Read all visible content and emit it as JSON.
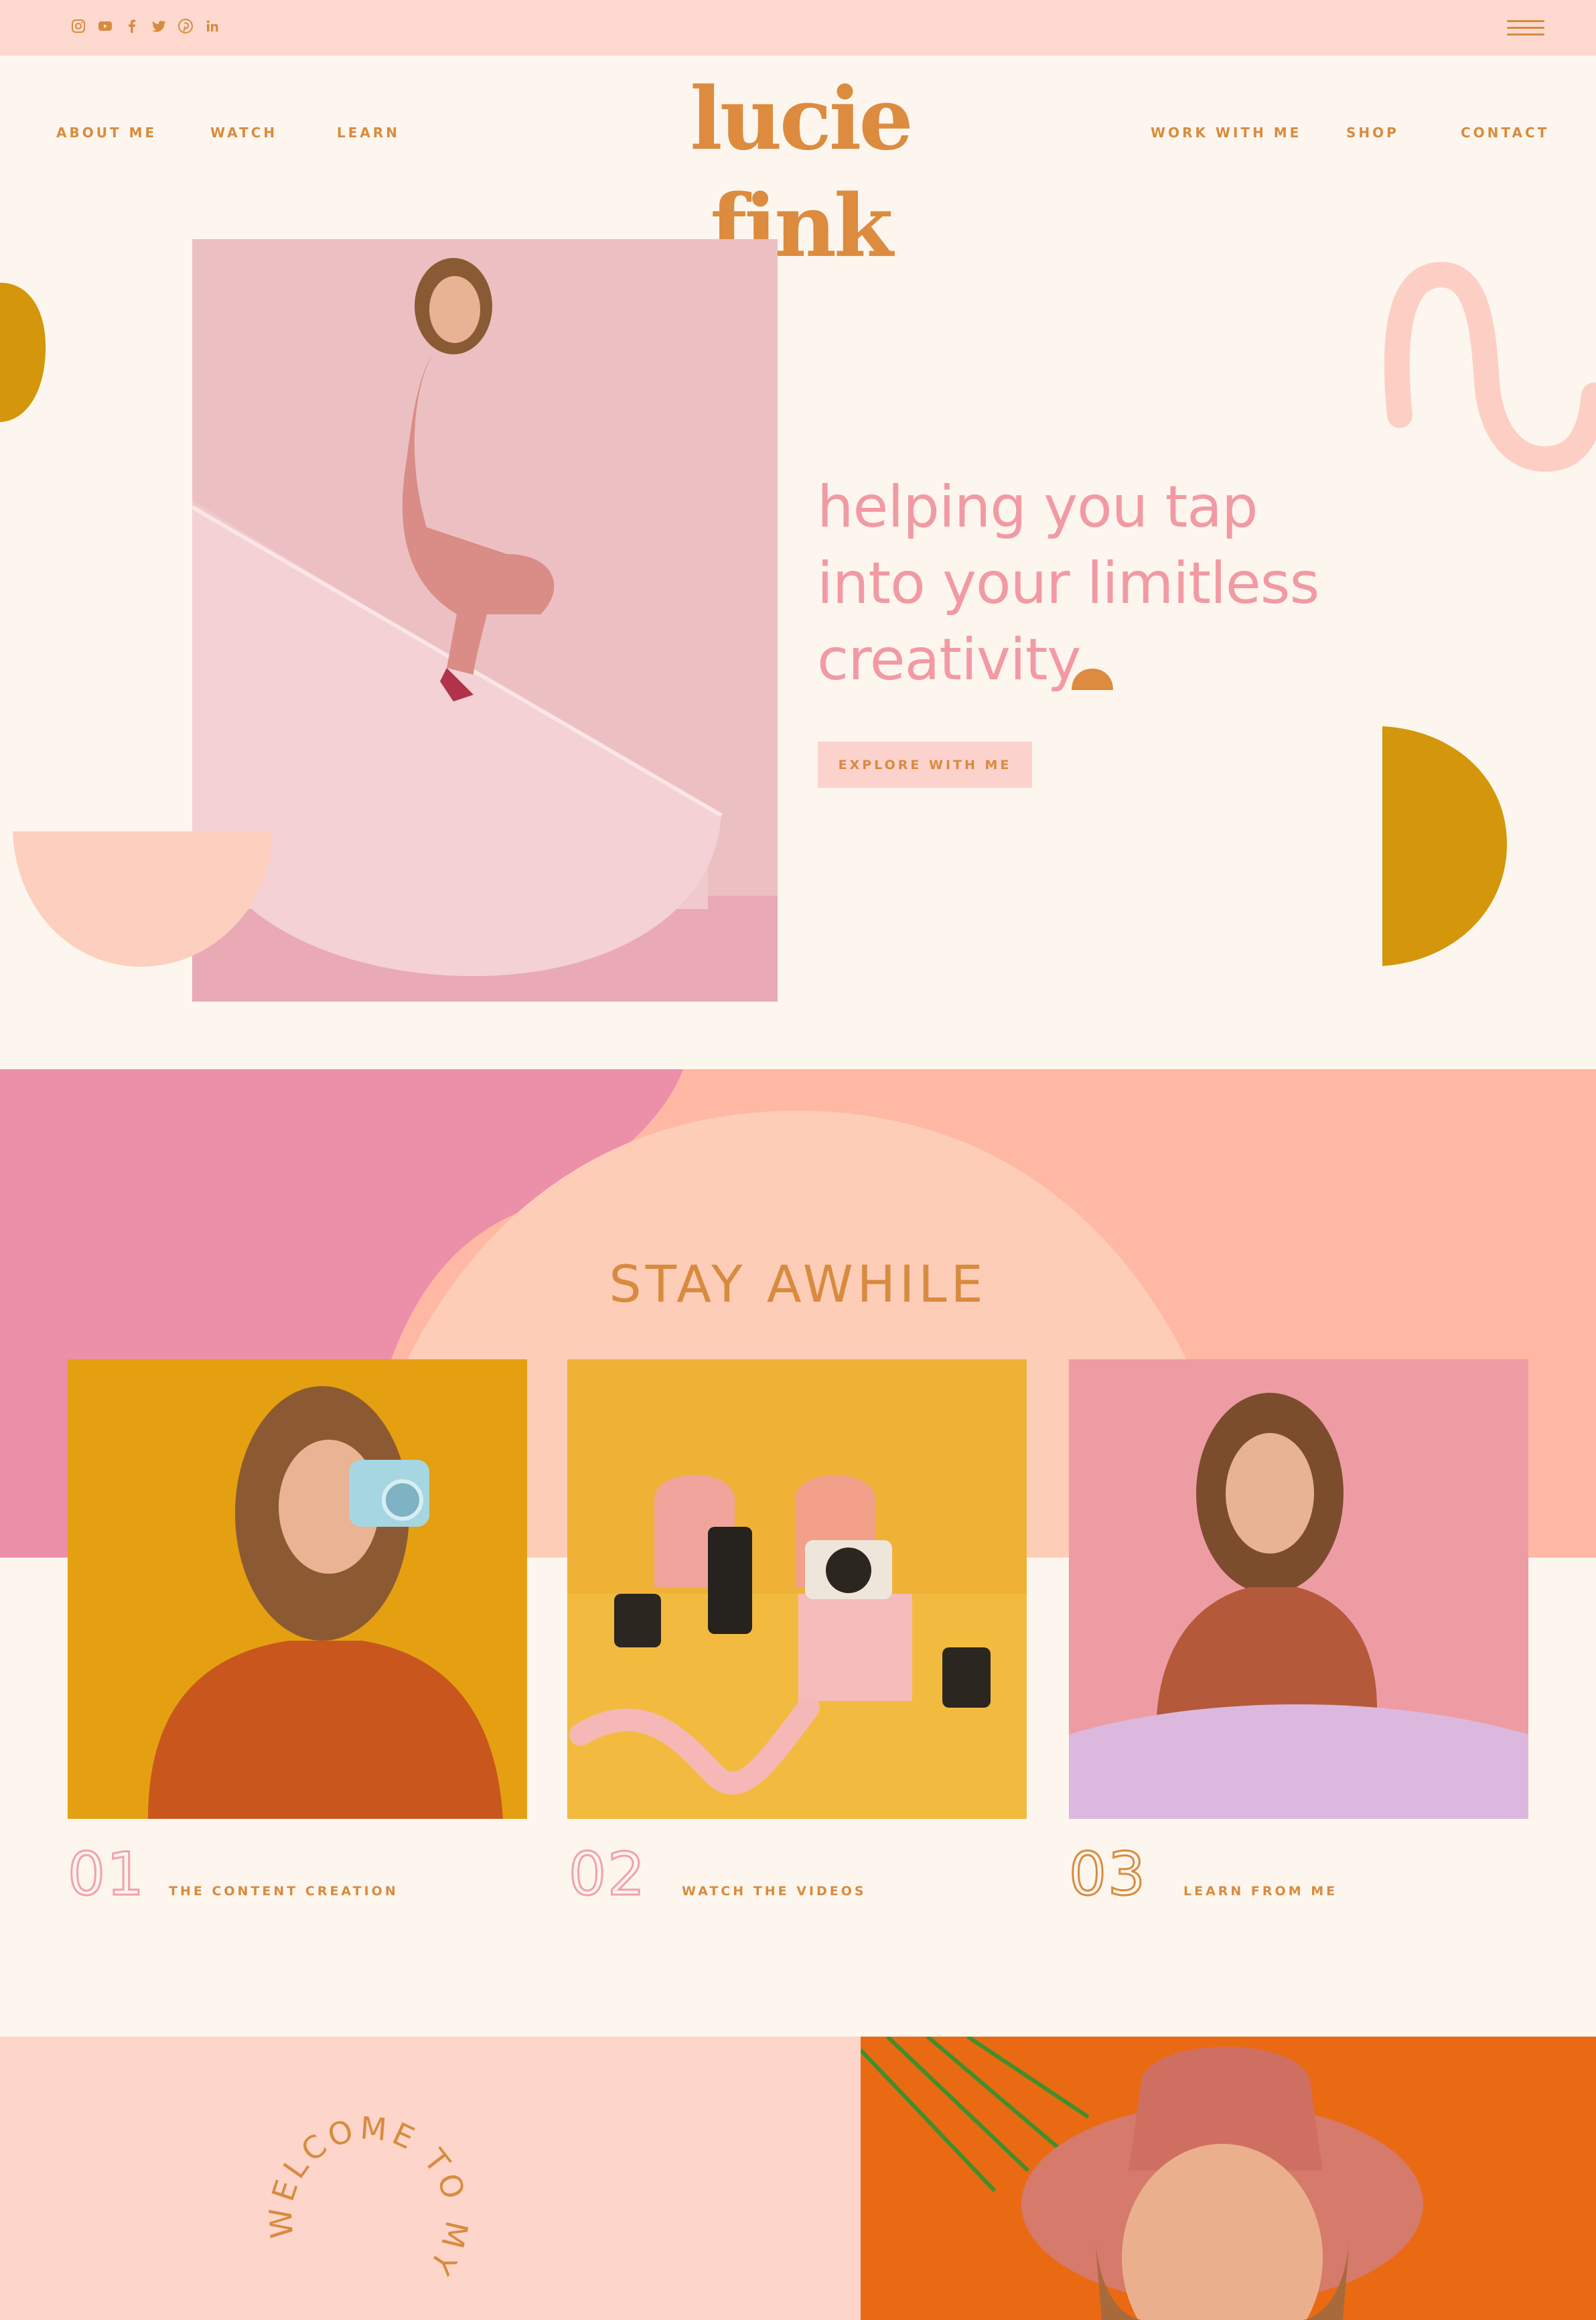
{
  "topbar": {
    "social_icons": [
      "instagram-icon",
      "youtube-icon",
      "facebook-icon",
      "twitter-icon",
      "pinterest-icon",
      "linkedin-icon"
    ],
    "menu_icon": "hamburger-icon"
  },
  "nav": {
    "left": [
      "ABOUT ME",
      "WATCH",
      "LEARN"
    ],
    "right": [
      "WORK WITH ME",
      "SHOP",
      "CONTACT"
    ],
    "logo": "lucie fink"
  },
  "hero": {
    "headline_lines": [
      "helping you tap",
      "into your limitless",
      "creativity"
    ],
    "cta": "EXPLORE WITH ME"
  },
  "stay": {
    "title": "STAY AWHILE",
    "cards": [
      {
        "number": "01",
        "label": "THE CONTENT CREATION"
      },
      {
        "number": "02",
        "label": "WATCH THE VIDEOS"
      },
      {
        "number": "03",
        "label": "LEARN FROM ME"
      }
    ]
  },
  "welcome": {
    "arc_text": "WELCOME TO MY"
  },
  "colors": {
    "brand": "#d88b3f",
    "pink_text": "#f29aa4",
    "topbar": "#fdd9cf",
    "page": "#fdf6ee",
    "mustard": "#d4960a",
    "orange": "#ea6a14"
  }
}
